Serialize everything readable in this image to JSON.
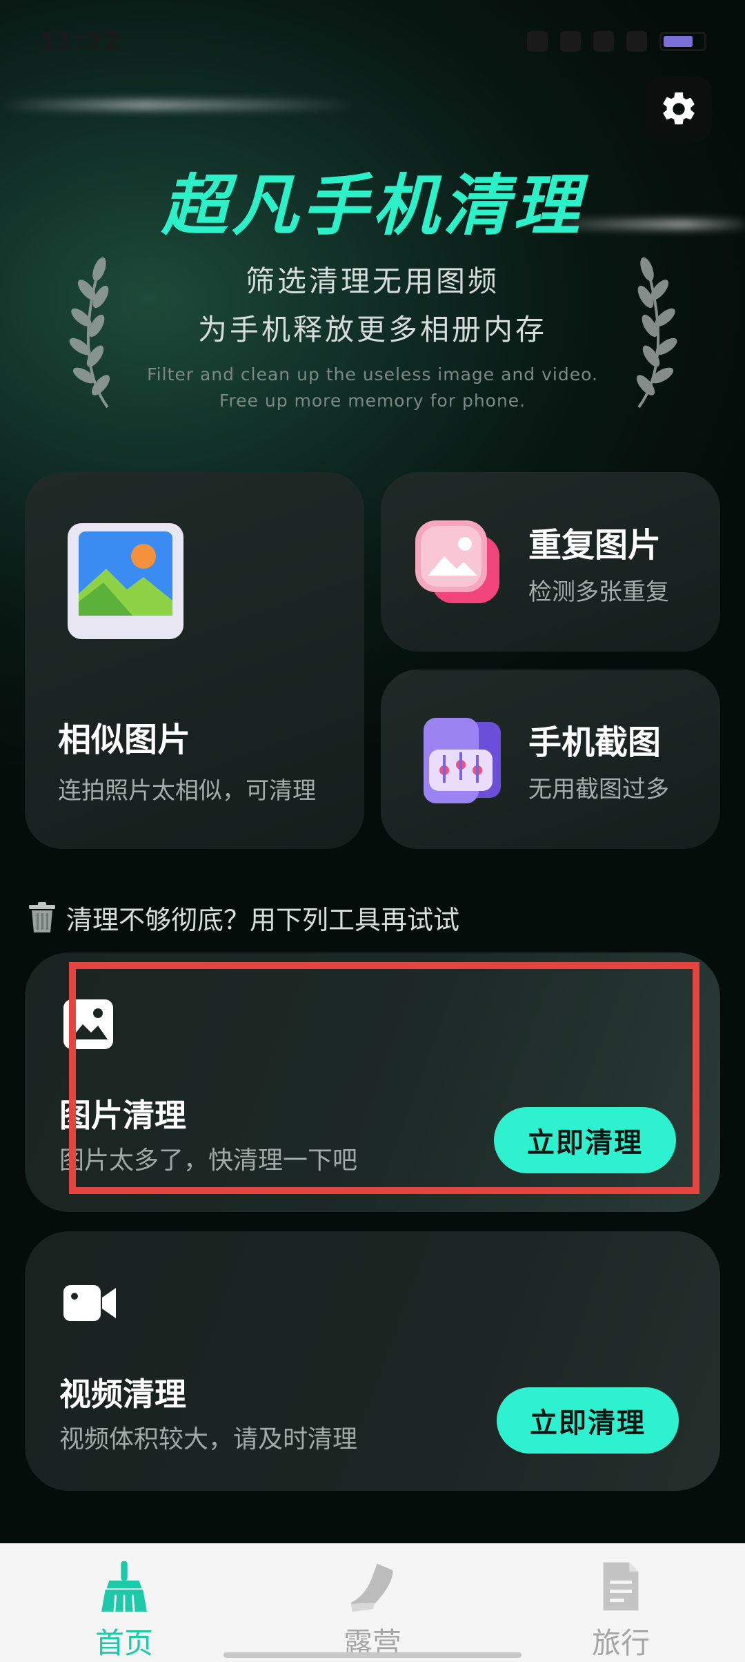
{
  "status_bar": {
    "time": "11:22",
    "battery_level_fraction": 0.65
  },
  "header": {
    "title": "超凡手机清理",
    "subtitle_line1": "筛选清理无用图频",
    "subtitle_line2": "为手机释放更多相册内存",
    "en_line1": "Filter and clean up the useless image and video.",
    "en_line2": "Free up more memory for phone.",
    "settings_icon": "gear-icon"
  },
  "feature_cards": {
    "similar": {
      "title": "相似图片",
      "desc": "连拍照片太相似，可清理",
      "icon": "landscape-photo-icon"
    },
    "duplicate": {
      "title": "重复图片",
      "desc": "检测多张重复",
      "icon": "duplicate-photo-icon"
    },
    "screenshot": {
      "title": "手机截图",
      "desc": "无用截图过多",
      "icon": "phone-screenshot-icon"
    }
  },
  "tip": {
    "icon": "trash-can-icon",
    "text": "清理不够彻底？用下列工具再试试"
  },
  "tools": {
    "image": {
      "title": "图片清理",
      "desc": "图片太多了，快清理一下吧",
      "button": "立即清理",
      "icon": "image-icon"
    },
    "video": {
      "title": "视频清理",
      "desc": "视频体积较大，请及时清理",
      "button": "立即清理",
      "icon": "video-camera-icon"
    }
  },
  "tabbar": {
    "items": [
      {
        "label": "首页",
        "icon": "broom-icon",
        "active": true
      },
      {
        "label": "露营",
        "icon": "shoe-icon",
        "active": false
      },
      {
        "label": "旅行",
        "icon": "document-icon",
        "active": false
      }
    ]
  },
  "colors": {
    "accent": "#2ef2cf",
    "title_teal": "#2cf0c8",
    "highlight": "#e6443f",
    "tab_active": "#1cc9a8"
  }
}
